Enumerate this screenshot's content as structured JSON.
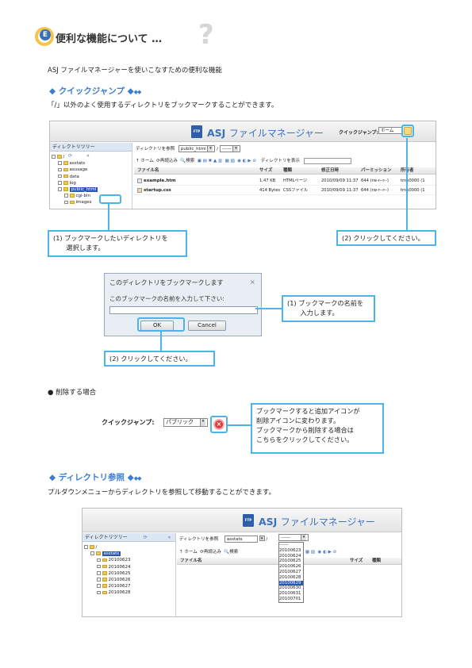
{
  "section": {
    "letter": "E",
    "title": "便利な機能について …",
    "question_mark": "?"
  },
  "intro": "ASJ ファイルマネージャーを使いこなすための便利な機能",
  "quickjump": {
    "heading": "クイックジャンプ",
    "description": "「/」以外のよく使用するディレクトリをブックマークすることができます。",
    "app_title_ascii": "ASJ",
    "app_title_kana": "ファイルマネージャー",
    "ftp_logo": "FTP",
    "qj_label": "クイックジャンプ:",
    "qj_value": "ホーム",
    "tree_header": "ディレクトリツリー",
    "tree_items": [
      "/",
      "asstats",
      "asusage",
      "data",
      "log",
      "public_html",
      "cgi-bin",
      "images"
    ],
    "dir_ref_label": "ディレクトリを参照",
    "dir_ref_value": "public_html",
    "dir_ref_second": "------",
    "toolbar": [
      "ホーム",
      "再読込み",
      "検索"
    ],
    "dir_display": "ディレクトリを表示",
    "columns": [
      "ファイル名",
      "サイズ",
      "種類",
      "修正日時",
      "パーミッション",
      "所有者"
    ],
    "files": [
      {
        "name": "example.htm",
        "size": "1.47 KB",
        "type": "HTMLページ",
        "date": "2010/09/09 11:37",
        "perm": "644 (rw-r--r--)",
        "owner": "tmu0000 (1"
      },
      {
        "name": "startup.css",
        "size": "414 Bytes",
        "type": "CSSファイル",
        "date": "2010/09/09 11:37",
        "perm": "644 (rw-r--r--)",
        "owner": "tmu0000 (1"
      }
    ],
    "callout_left": "(1) ブックマークしたいディレクトリを\n　　選択します。",
    "callout_right": "(2) クリックしてください。"
  },
  "dialog": {
    "title": "このディレクトリをブックマークします",
    "close": "×",
    "prompt": "このブックマークの名前を入力して下さい:",
    "ok": "OK",
    "cancel": "Cancel",
    "callout_name": "(1) ブックマークの名前を\n　　入力します。",
    "callout_click": "(2) クリックしてください。"
  },
  "delete": {
    "bullet": "● 削除する場合",
    "qj_label": "クイックジャンプ:",
    "qj_value": "パブリック",
    "icon": "×",
    "callout": "ブックマークすると追加アイコンが\n削除アイコンに変わります。\nブックマークから削除する場合は\nこちらをクリックしてください。"
  },
  "dirref": {
    "heading": "ディレクトリ参照",
    "description": "プルダウンメニューからディレクトリを参照して移動することができます。",
    "dir_ref_value": "asstats",
    "dir_ref_second": "------",
    "tree_items": [
      "/",
      "asstats",
      "20100623",
      "20100624",
      "20100625",
      "20100626",
      "20100627",
      "20100628"
    ],
    "dropdown": [
      "------",
      "20100623",
      "20100624",
      "20100625",
      "20100626",
      "20100627",
      "20100628",
      "20100629",
      "20100630",
      "20100631",
      "20100701"
    ],
    "dropdown_selected_index": 7,
    "columns": [
      "ファイル名",
      "サイズ",
      "種類"
    ]
  },
  "colors": {
    "accent": "#4ab5e6",
    "heading": "#3a7dd1",
    "badge": "#f3c64a",
    "delete": "#e23b3b"
  }
}
